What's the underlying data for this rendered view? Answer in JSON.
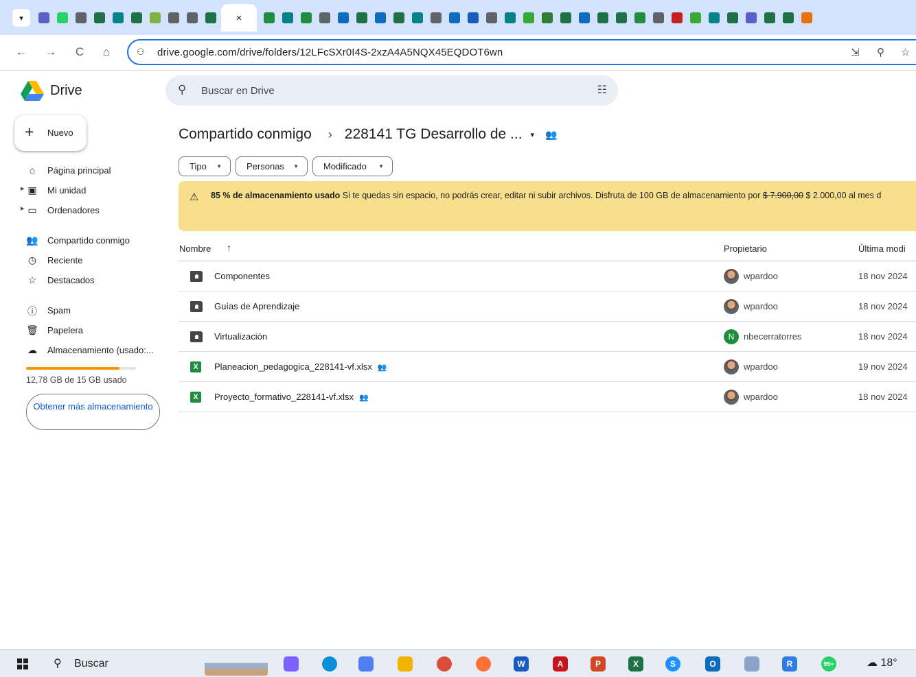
{
  "browser": {
    "tab_close": "×",
    "tab_favicon_colors": [
      "#5b5fc7",
      "#25d366",
      "#5f6368",
      "#1e7145",
      "#038387",
      "#1e7145",
      "#7cb342",
      "#5f6368",
      "#5f6368",
      "#1e7145",
      "ACTIVE",
      "#1e8e3e",
      "#038387",
      "#1e8e3e",
      "#5f6368",
      "#0f6cbd",
      "#1e7145",
      "#0f6cbd",
      "#1e7145",
      "#038387",
      "#5f6368",
      "#0f6cbd",
      "#185abd",
      "#5f6368",
      "#038387",
      "#39a935",
      "#2e7d32",
      "#1e7145",
      "#0f6cbd",
      "#1e7145",
      "#1e7145",
      "#1e8e3e",
      "#5f6368",
      "#c5221f",
      "#39a935",
      "#038387",
      "#1e7145",
      "#5b5fc7",
      "#1e7145",
      "#1e7145",
      "#e8710a"
    ],
    "url": "drive.google.com/drive/folders/12LFcSXr0I4S-2xzA4A5NQX45EQDOT6wn",
    "icons": {
      "back": "←",
      "forward": "→",
      "reload": "C",
      "home": "⌂",
      "site_info": "⚇",
      "install": "⇲",
      "zoom": "⚲",
      "bookmark": "☆"
    }
  },
  "drive": {
    "app_name": "Drive",
    "search_placeholder": "Buscar en Drive",
    "new_label": "Nuevo",
    "nav": [
      {
        "label": "Página principal",
        "icon": "⌂",
        "arrow": false
      },
      {
        "label": "Mi unidad",
        "icon": "▣",
        "arrow": true
      },
      {
        "label": "Ordenadores",
        "icon": "▭",
        "arrow": true
      },
      {
        "label": "Compartido conmigo",
        "icon": "👥",
        "arrow": false
      },
      {
        "label": "Reciente",
        "icon": "◷",
        "arrow": false
      },
      {
        "label": "Destacados",
        "icon": "☆",
        "arrow": false
      },
      {
        "label": "Spam",
        "icon": "ⓘ",
        "arrow": false
      },
      {
        "label": "Papelera",
        "icon": "🗑",
        "arrow": false
      },
      {
        "label": "Almacenamiento (usado:...",
        "icon": "☁",
        "arrow": false
      }
    ],
    "storage": {
      "used_fraction": 0.85,
      "text": "12,78 GB de 15 GB usado",
      "cta": "Obtener más almacenamiento"
    },
    "breadcrumb": {
      "parent": "Compartido conmigo",
      "separator": "›",
      "current": "228141 TG Desarrollo de ...",
      "caret": "▾"
    },
    "filters": [
      "Tipo",
      "Personas",
      "Modificado"
    ],
    "banner": {
      "bold": "85 % de almacenamiento usado",
      "text": "Si te quedas sin espacio, no podrás crear, editar ni subir archivos. Disfruta de 100 GB de almacenamiento por",
      "old_price": "$ 7.900,00",
      "new_price": "$ 2.000,00 al mes d"
    },
    "columns": {
      "name": "Nombre",
      "sort": "↑",
      "owner": "Propietario",
      "modified": "Última modi"
    },
    "files": [
      {
        "name": "Componentes",
        "type": "folder",
        "shared": false,
        "owner": "wpardoo",
        "avatar": "photo",
        "avatar_letter": "",
        "date": "18 nov 2024"
      },
      {
        "name": "Guías de Aprendizaje",
        "type": "folder",
        "shared": false,
        "owner": "wpardoo",
        "avatar": "photo",
        "avatar_letter": "",
        "date": "18 nov 2024"
      },
      {
        "name": "Virtualización",
        "type": "folder",
        "shared": false,
        "owner": "nbecerratorres",
        "avatar": "letter",
        "avatar_letter": "N",
        "date": "18 nov 2024"
      },
      {
        "name": "Planeacion_pedagogica_228141-vf.xlsx",
        "type": "sheet",
        "shared": true,
        "owner": "wpardoo",
        "avatar": "photo",
        "avatar_letter": "",
        "date": "19 nov 2024"
      },
      {
        "name": "Proyecto_formativo_228141-vf.xlsx",
        "type": "sheet",
        "shared": true,
        "owner": "wpardoo",
        "avatar": "photo",
        "avatar_letter": "",
        "date": "18 nov 2024"
      }
    ],
    "sheet_glyph": "X",
    "shared_glyph": "👥"
  },
  "taskbar": {
    "search_label": "Buscar",
    "apps": [
      {
        "name": "copilot",
        "color": "#7b61ff",
        "glyph": ""
      },
      {
        "name": "edge",
        "color": "#0c8fd8",
        "glyph": ""
      },
      {
        "name": "photos",
        "color": "#4f7ff2",
        "glyph": ""
      },
      {
        "name": "explorer",
        "color": "#f0b400",
        "glyph": ""
      },
      {
        "name": "chrome",
        "color": "#dd4b39",
        "glyph": ""
      },
      {
        "name": "firefox",
        "color": "#ff7139",
        "glyph": ""
      },
      {
        "name": "word",
        "color": "#185abd",
        "glyph": "W"
      },
      {
        "name": "acrobat",
        "color": "#c4161c",
        "glyph": "A"
      },
      {
        "name": "powerpoint",
        "color": "#d24726",
        "glyph": "P"
      },
      {
        "name": "excel",
        "color": "#1e7145",
        "glyph": "X"
      },
      {
        "name": "skype",
        "color": "#1e90ff",
        "glyph": "S"
      },
      {
        "name": "outlook",
        "color": "#0f6cbd",
        "glyph": "O"
      },
      {
        "name": "screenshot",
        "color": "#8aa4c8",
        "glyph": ""
      },
      {
        "name": "r-app",
        "color": "#2d7be5",
        "glyph": "R"
      },
      {
        "name": "whatsapp",
        "color": "#25d366",
        "glyph": "99+"
      }
    ],
    "weather": "18°"
  }
}
